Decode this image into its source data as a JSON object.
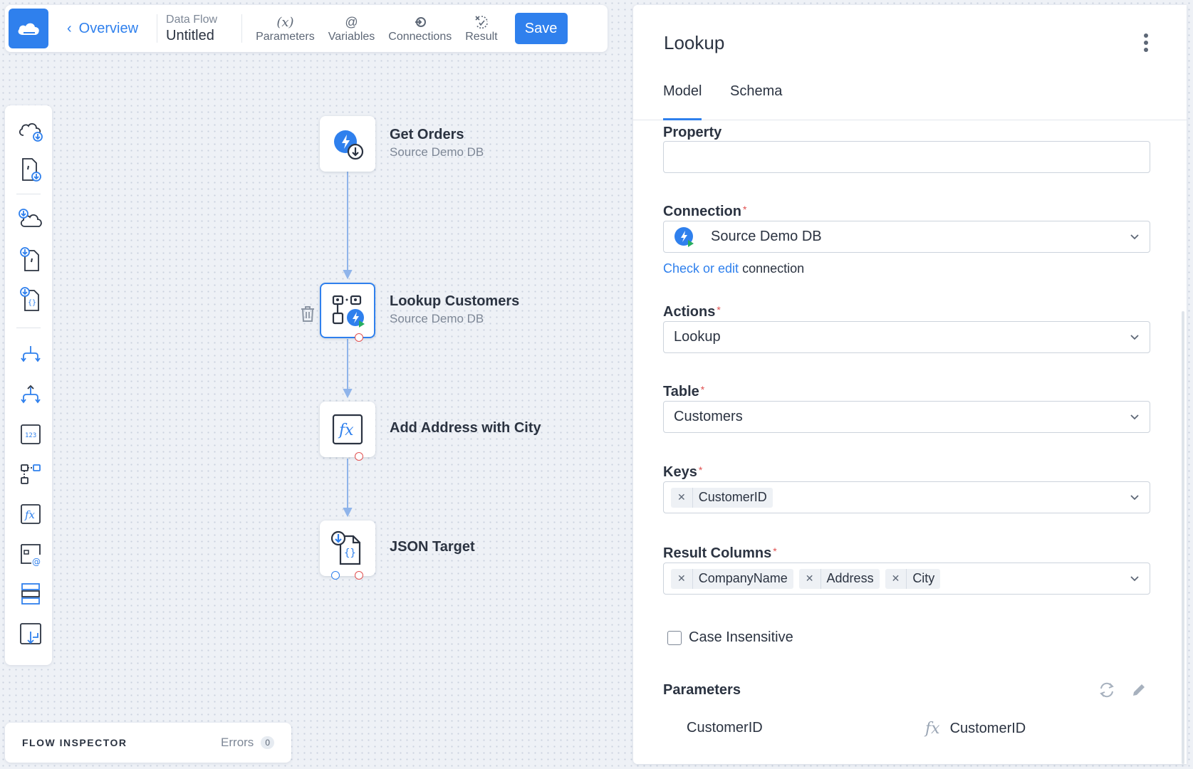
{
  "toolbar": {
    "back_label": "Overview",
    "flow_kind": "Data Flow",
    "flow_name": "Untitled",
    "buttons": [
      {
        "label": "Parameters",
        "icon": "x-variable-icon"
      },
      {
        "label": "Variables",
        "icon": "at-icon"
      },
      {
        "label": "Connections",
        "icon": "connection-icon"
      },
      {
        "label": "Result",
        "icon": "result-icon"
      }
    ],
    "save_label": "Save"
  },
  "palette": [
    "cloud-source-icon",
    "csv-source-icon",
    "cloud-target-icon",
    "csv-target-icon",
    "json-target-icon",
    "split-icon",
    "merge-icon",
    "row-count-icon",
    "lookup-icon",
    "expression-icon",
    "variable-icon",
    "buffer-icon",
    "data-import-icon"
  ],
  "canvas": {
    "nodes": [
      {
        "title": "Get Orders",
        "subtitle": "Source Demo DB",
        "icon": "cloud-source-icon"
      },
      {
        "title": "Lookup Customers",
        "subtitle": "Source Demo DB",
        "icon": "lookup-icon"
      },
      {
        "title": "Add Address with City",
        "subtitle": "",
        "icon": "expression-icon"
      },
      {
        "title": "JSON Target",
        "subtitle": "",
        "icon": "json-target-icon"
      }
    ]
  },
  "flow_inspector": {
    "label": "FLOW INSPECTOR",
    "errors_label": "Errors",
    "errors_count": "0"
  },
  "panel": {
    "title": "Lookup",
    "tabs": [
      "Model",
      "Schema"
    ],
    "property": {
      "label": "Property",
      "value": ""
    },
    "connection": {
      "label": "Connection",
      "value": "Source Demo DB",
      "link_text": "Check or edit",
      "link_suffix": " connection"
    },
    "actions": {
      "label": "Actions",
      "value": "Lookup"
    },
    "table": {
      "label": "Table",
      "value": "Customers"
    },
    "keys": {
      "label": "Keys",
      "tags": [
        "CustomerID"
      ]
    },
    "result_columns": {
      "label": "Result Columns",
      "tags": [
        "CompanyName",
        "Address",
        "City"
      ]
    },
    "case_insensitive": {
      "label": "Case Insensitive",
      "checked": false
    },
    "parameters": {
      "label": "Parameters",
      "rows": [
        {
          "name": "CustomerID",
          "value": "CustomerID"
        }
      ]
    }
  },
  "colors": {
    "accent": "#2f80ed",
    "required": "#e05050",
    "port_output": "#e05050"
  }
}
